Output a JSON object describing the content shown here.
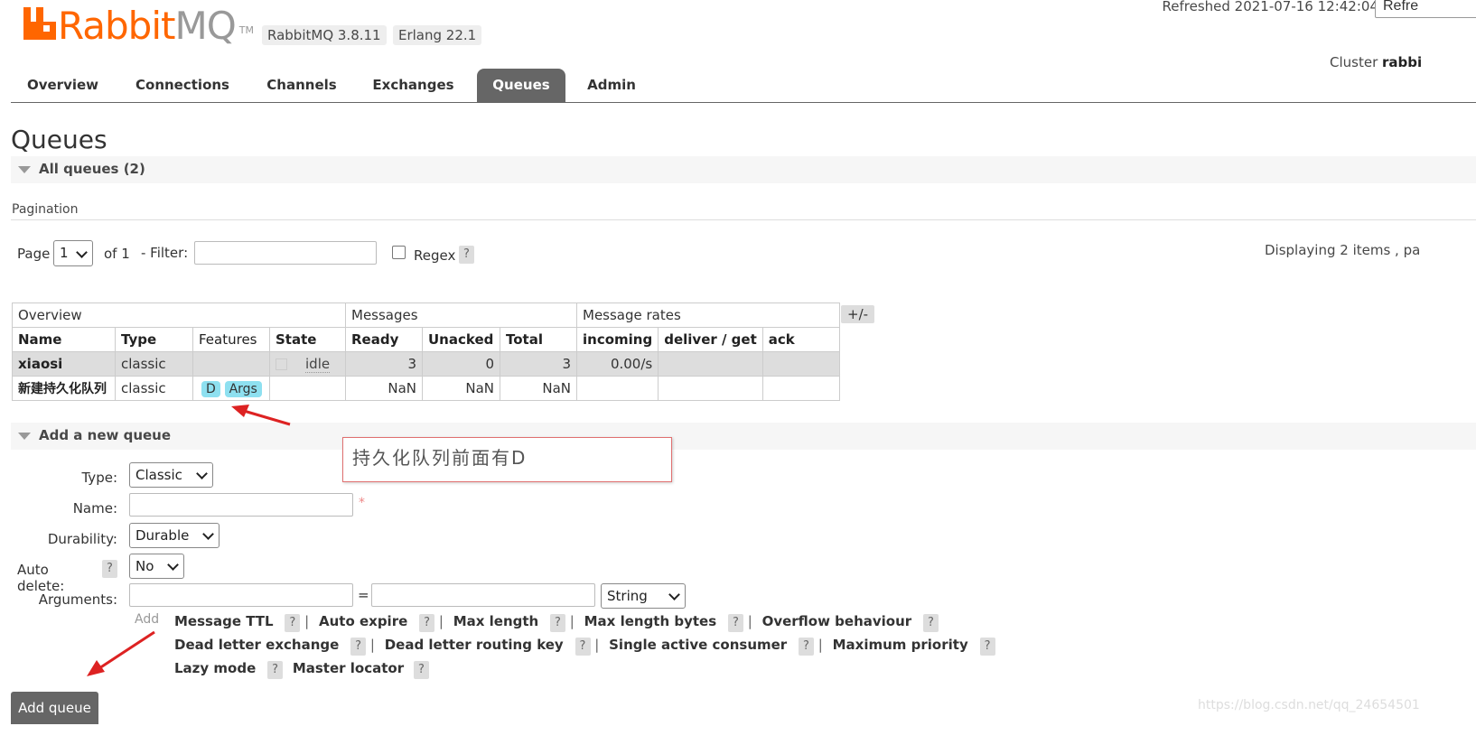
{
  "header": {
    "logo_rabbit": "Rabbit",
    "logo_mq": "MQ",
    "logo_tm": "TM",
    "version_rabbitmq": "RabbitMQ 3.8.11",
    "version_erlang": "Erlang 22.1",
    "refreshed": "Refreshed 2021-07-16 12:42:04",
    "refresh_button": "Refre",
    "cluster_label": "Cluster",
    "cluster_name": "rabbi"
  },
  "nav": {
    "tabs": [
      "Overview",
      "Connections",
      "Channels",
      "Exchanges",
      "Queues",
      "Admin"
    ],
    "active": "Queues"
  },
  "page_title": "Queues",
  "all_queues": {
    "heading": "All queues (2)",
    "pagination_label": "Pagination",
    "page_label": "Page",
    "page_value": "1",
    "of_label": "of 1",
    "filter_label": "- Filter:",
    "filter_value": "",
    "regex_label": "Regex",
    "help": "?",
    "displaying": "Displaying 2 items , pa",
    "plusminus": "+/-"
  },
  "table": {
    "groups": [
      "Overview",
      "Messages",
      "Message rates"
    ],
    "columns": [
      "Name",
      "Type",
      "Features",
      "State",
      "Ready",
      "Unacked",
      "Total",
      "incoming",
      "deliver / get",
      "ack"
    ],
    "rows": [
      {
        "name": "xiaosi",
        "type": "classic",
        "features": [],
        "state": "idle",
        "ready": "3",
        "unacked": "0",
        "total": "3",
        "incoming": "0.00/s",
        "deliver_get": "",
        "ack": ""
      },
      {
        "name": "新建持久化队列",
        "type": "classic",
        "features": [
          "D",
          "Args"
        ],
        "state": "",
        "ready": "NaN",
        "unacked": "NaN",
        "total": "NaN",
        "incoming": "",
        "deliver_get": "",
        "ack": ""
      }
    ]
  },
  "annotation": {
    "note": "持久化队列前面有D"
  },
  "add_queue": {
    "heading": "Add a new queue",
    "type_label": "Type:",
    "type_value": "Classic",
    "name_label": "Name:",
    "name_value": "",
    "required_mark": "*",
    "durability_label": "Durability:",
    "durability_value": "Durable",
    "auto_delete_label": "Auto delete:",
    "auto_delete_value": "No",
    "arguments_label": "Arguments:",
    "equals": "=",
    "arg_type_value": "String",
    "add_label": "Add",
    "options_line1": [
      "Message TTL",
      "Auto expire",
      "Max length",
      "Max length bytes",
      "Overflow behaviour"
    ],
    "options_line2": [
      "Dead letter exchange",
      "Dead letter routing key",
      "Single active consumer",
      "Maximum priority"
    ],
    "options_line3": [
      "Lazy mode",
      "Master locator"
    ],
    "pipe": "|",
    "submit": "Add queue"
  },
  "watermark": "https://blog.csdn.net/qq_24654501",
  "colors": {
    "brand_orange": "#ff6600",
    "nav_active": "#666666",
    "feature_badge": "#8ee0f0",
    "annotation_arrow": "#dd2222"
  }
}
